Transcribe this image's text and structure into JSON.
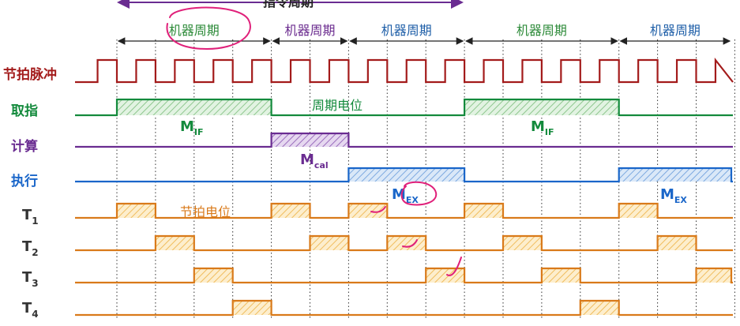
{
  "instruction_cycle_label": "指令周期",
  "machine_cycles": [
    {
      "label": "机器周期",
      "color": "#2e8b3a"
    },
    {
      "label": "机器周期",
      "color": "#6b2c8f"
    },
    {
      "label": "机器周期",
      "color": "#1f5fa8"
    },
    {
      "label": "机器周期",
      "color": "#2e8b3a"
    },
    {
      "label": "机器周期",
      "color": "#1f5fa8"
    }
  ],
  "signals": {
    "clock": {
      "label": "节拍脉冲",
      "color": "#a31b1b"
    },
    "fetch": {
      "label": "取指",
      "color": "#138a3c"
    },
    "calc": {
      "label": "计算",
      "color": "#6a2c91"
    },
    "exec": {
      "label": "执行",
      "color": "#1a66c9"
    },
    "t1": {
      "label": "T",
      "sub": "1",
      "color": "#d97a1a"
    },
    "t2": {
      "label": "T",
      "sub": "2",
      "color": "#d97a1a"
    },
    "t3": {
      "label": "T",
      "sub": "3",
      "color": "#d97a1a"
    },
    "t4": {
      "label": "T",
      "sub": "4",
      "color": "#d97a1a"
    }
  },
  "annotations": {
    "cycle_level": "周期电位",
    "beat_level": "节拍电位",
    "m_if_1": {
      "main": "M",
      "sub": "IF"
    },
    "m_cal": {
      "main": "M",
      "sub": "cal"
    },
    "m_ex_1": {
      "main": "M",
      "sub": "EX"
    },
    "m_if_2": {
      "main": "M",
      "sub": "IF"
    },
    "m_ex_2": {
      "main": "M",
      "sub": "EX"
    }
  },
  "colors": {
    "cycle_header": "#2e8b3a",
    "dotted_grid": "#333333",
    "handwriting": "#e0207a",
    "fill_hatch": "#f0c060"
  }
}
